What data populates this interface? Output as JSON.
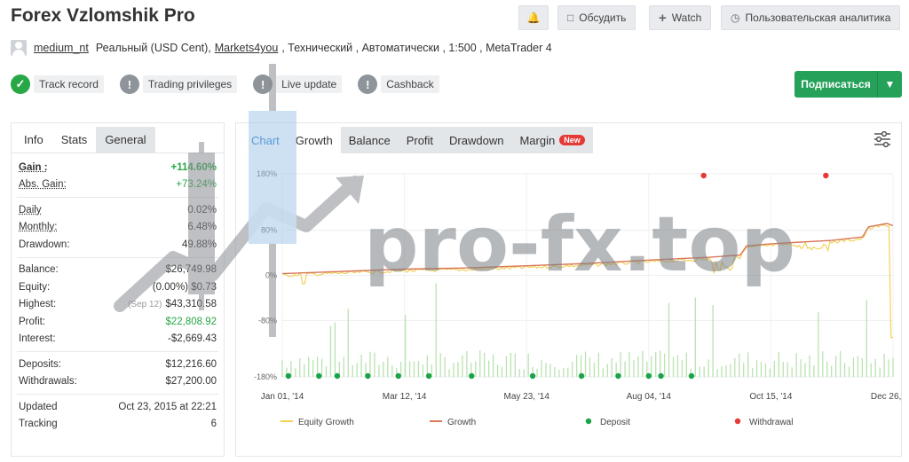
{
  "header": {
    "title": "Forex Vzlomshik Pro",
    "discuss_label": "Обсудить",
    "watch_label": "Watch",
    "analytics_label": "Пользовательская аналитика"
  },
  "meta": {
    "user": "medium_nt",
    "text1": "Реальный (USD Cent),",
    "broker": "Markets4you",
    "text2": ", Технический , Автоматически , 1:500 , MetaTrader 4"
  },
  "badges": [
    {
      "label": "Track record",
      "status": "ok"
    },
    {
      "label": "Trading privileges",
      "status": "warn"
    },
    {
      "label": "Live update",
      "status": "warn"
    },
    {
      "label": "Cashback",
      "status": "warn"
    }
  ],
  "subscribe_label": "Подписаться",
  "left_tabs": [
    "Info",
    "Stats",
    "General"
  ],
  "stats": {
    "gain_k": "Gain :",
    "gain_v": "+114.60%",
    "abs_k": "Abs. Gain:",
    "abs_v": "+73.24%",
    "daily_k": "Daily",
    "daily_v": "0.02%",
    "monthly_k": "Monthly:",
    "monthly_v": "6.48%",
    "dd_k": "Drawdown:",
    "dd_v": "49.88%",
    "balance_k": "Balance:",
    "balance_v": "$26,749.98",
    "equity_k": "Equity:",
    "equity_pct": "(0.00%)",
    "equity_v": "$0.73",
    "highest_k": "Highest:",
    "highest_date": "(Sep 12)",
    "highest_v": "$43,310.58",
    "profit_k": "Profit:",
    "profit_v": "$22,808.92",
    "interest_k": "Interest:",
    "interest_v": "-$2,669.43",
    "deposits_k": "Deposits:",
    "deposits_v": "$12,216.60",
    "withdrawals_k": "Withdrawals:",
    "withdrawals_v": "$27,200.00",
    "updated_k": "Updated",
    "updated_v": "Oct 23, 2015 at 22:21",
    "tracking_k": "Tracking",
    "tracking_v": "6"
  },
  "right_tabs": [
    "Chart",
    "Growth",
    "Balance",
    "Profit",
    "Drawdown",
    "Margin"
  ],
  "new_badge": "New",
  "watermark": "pro-fx.top",
  "chart_data": {
    "type": "line",
    "x_tick_labels": [
      "Jan 01, '14",
      "Mar 12, '14",
      "May 23, '14",
      "Aug 04, '14",
      "Oct 15, '14",
      "Dec 26, '14"
    ],
    "y_tick_labels": [
      "180%",
      "80%",
      "0%",
      "-80%",
      "-180%"
    ],
    "ylim": [
      -180,
      180
    ],
    "grid": true,
    "legend_position": "bottom",
    "legend": [
      "Equity Growth",
      "Growth",
      "Deposit",
      "Withdrawal"
    ],
    "colors": {
      "equity": "#f2d25a",
      "growth": "#d9785a",
      "deposit": "#1aa34a",
      "withdrawal": "#e53935",
      "bars": "#b9e3b0"
    },
    "growth": [
      [
        0,
        3
      ],
      [
        0.1,
        7
      ],
      [
        0.2,
        11
      ],
      [
        0.3,
        13
      ],
      [
        0.4,
        17
      ],
      [
        0.5,
        21
      ],
      [
        0.6,
        27
      ],
      [
        0.7,
        32
      ],
      [
        0.75,
        36
      ],
      [
        0.76,
        52
      ],
      [
        0.8,
        56
      ],
      [
        0.9,
        62
      ],
      [
        0.95,
        68
      ],
      [
        0.96,
        86
      ],
      [
        0.99,
        92
      ],
      [
        1,
        88
      ]
    ],
    "deposits_x": [
      0.01,
      0.06,
      0.09,
      0.14,
      0.19,
      0.24,
      0.31,
      0.41,
      0.49,
      0.55,
      0.6,
      0.62,
      0.67
    ],
    "withdrawals_x": [
      0.69,
      0.89
    ]
  }
}
